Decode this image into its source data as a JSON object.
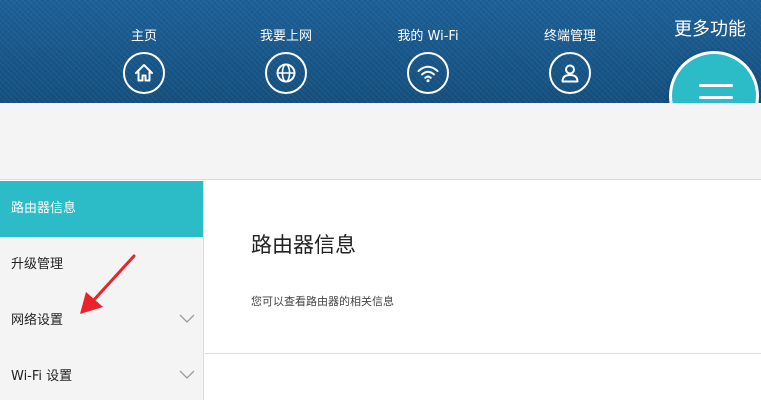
{
  "header": {
    "nav": [
      {
        "label": "主页",
        "icon": "home-icon"
      },
      {
        "label": "我要上网",
        "icon": "globe-icon"
      },
      {
        "label": "我的 Wi-Fi",
        "icon": "wifi-icon"
      },
      {
        "label": "终端管理",
        "icon": "user-icon"
      }
    ],
    "more": {
      "label": "更多功能",
      "icon": "menu-icon"
    }
  },
  "sidebar": {
    "items": [
      {
        "label": "路由器信息",
        "active": true
      },
      {
        "label": "升级管理",
        "active": false
      },
      {
        "label": "网络设置",
        "active": false,
        "expandable": true
      },
      {
        "label": "Wi-Fi 设置",
        "active": false,
        "expandable": true
      }
    ]
  },
  "content": {
    "title": "路由器信息",
    "description": "您可以查看路由器的相关信息"
  },
  "colors": {
    "header": "#1a5a8f",
    "accent": "#2bbcc8",
    "annotation": "#e8232a"
  }
}
